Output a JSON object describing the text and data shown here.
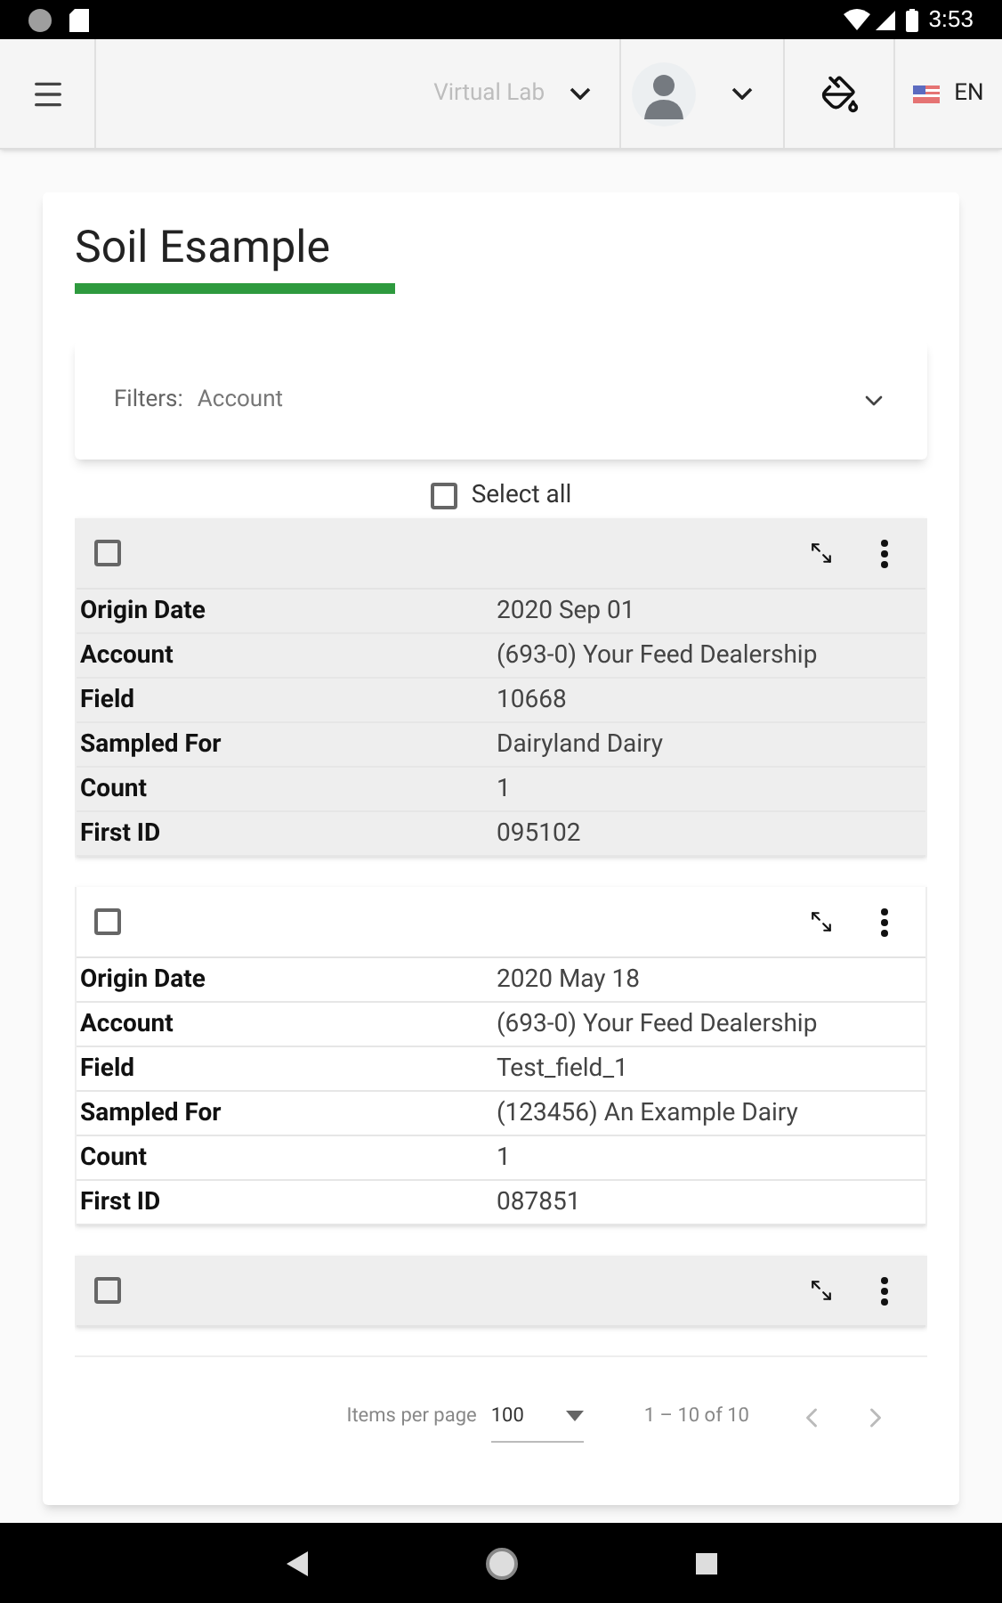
{
  "status_bar": {
    "time": "3:53"
  },
  "toolbar": {
    "lab": "Virtual Lab",
    "language": "EN"
  },
  "page": {
    "title": "Soil Esample"
  },
  "filters": {
    "label": "Filters:",
    "value": "Account",
    "expanded": false
  },
  "select_all": {
    "label": "Select all",
    "checked": false
  },
  "records": [
    {
      "checked": false,
      "fields": [
        {
          "label": "Origin Date",
          "value": "2020 Sep 01"
        },
        {
          "label": "Account",
          "value": "(693-0) Your Feed Dealership"
        },
        {
          "label": "Field",
          "value": "10668"
        },
        {
          "label": "Sampled For",
          "value": "Dairyland Dairy"
        },
        {
          "label": "Count",
          "value": "1"
        },
        {
          "label": "First ID",
          "value": "095102"
        }
      ]
    },
    {
      "checked": false,
      "fields": [
        {
          "label": "Origin Date",
          "value": "2020 May 18"
        },
        {
          "label": "Account",
          "value": "(693-0) Your Feed Dealership"
        },
        {
          "label": "Field",
          "value": "Test_field_1"
        },
        {
          "label": "Sampled For",
          "value": "(123456) An Example Dairy"
        },
        {
          "label": "Count",
          "value": "1"
        },
        {
          "label": "First ID",
          "value": "087851"
        }
      ]
    },
    {
      "checked": false
    }
  ],
  "paginator": {
    "label": "Items per page",
    "page_size": "100",
    "range": "1 – 10 of 10"
  }
}
